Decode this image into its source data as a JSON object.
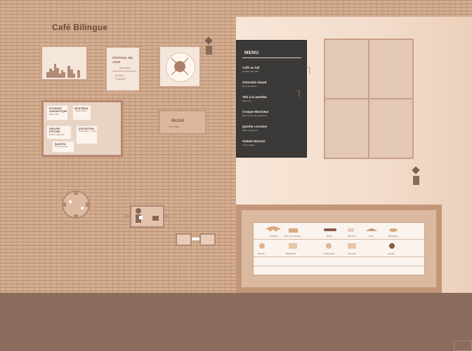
{
  "sign": {
    "title": "Café Bilingue"
  },
  "jazz_poster": {
    "title": "FESTIVAL DE JAZZ",
    "city": "MONTRÉAL",
    "dates": [
      "28 JUIN -",
      "7 JUILLET"
    ]
  },
  "notes": [
    {
      "title": "ÉCHANGE LINGUISTIQUE",
      "sub": "Mardi 19h"
    },
    {
      "title": "MONTREAL",
      "sub": "Visite guidée"
    },
    {
      "title": "GROUPE D'ÉTUDE",
      "sub": "Mardi • Mercredi"
    },
    {
      "title": "EXPOSITION",
      "sub": "d'étudiants · 20 juin"
    },
    {
      "title": "BARISTA",
      "sub": "Temps partiel"
    }
  ],
  "pennant": {
    "name": "McGill",
    "sub": "Université"
  },
  "menu": {
    "title": "MENU",
    "items": [
      {
        "name": "Café au lait",
        "desc": "(Coffee with milk)"
      },
      {
        "name": "Chocolat chaud",
        "desc": "(Hot chocolate)"
      },
      {
        "name": "Thé à la menthe",
        "desc": "(Mint tea)"
      },
      {
        "name": "Croque Monsieur",
        "desc": "(Ham & cheese sandwich)"
      },
      {
        "name": "Quiche Lorraine",
        "desc": "(Bacon-egg tart)"
      },
      {
        "name": "Salade Niçoise",
        "desc": "(Tuna salad)"
      }
    ]
  },
  "pastries_row1": [
    "Croissant",
    "Pain au Chocolat",
    "Éclair",
    "Macaron",
    "Tarte",
    "Madeleine"
  ],
  "pastries_row2": [
    "Brioche",
    "Millefeuille",
    "Chouquette",
    "Financier",
    "Canelé"
  ],
  "icons": [
    "wall-lamp-icon",
    "clock-icon",
    "plate-icon",
    "outlet-icon"
  ],
  "colors": {
    "accent": "#6b4a3a",
    "menu_board": "#3c3a38",
    "wall": "#d4ae91",
    "floor": "#8b6c5c"
  }
}
